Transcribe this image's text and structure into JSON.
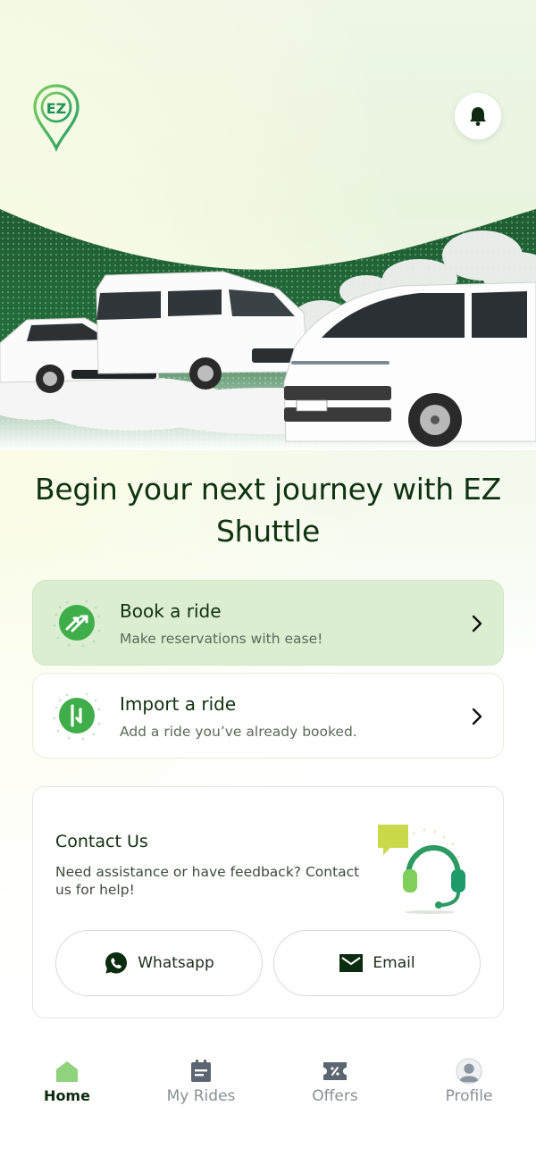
{
  "brand": {
    "logo_text": "EZ",
    "accent": "#3fae4a",
    "dark": "#0f3311"
  },
  "header": {
    "notification_icon": "bell-icon"
  },
  "hero": {
    "headline": "Begin your next journey with EZ Shuttle"
  },
  "actions": [
    {
      "title": "Book a ride",
      "subtitle": "Make reservations with ease!",
      "icon": "swap-arrows-icon"
    },
    {
      "title": "Import a ride",
      "subtitle": "Add a ride you’ve already booked.",
      "icon": "import-icon"
    }
  ],
  "contact": {
    "title": "Contact Us",
    "description": "Need assistance or have feedback? Contact us for help!",
    "whatsapp_label": "Whatsapp",
    "email_label": "Email"
  },
  "nav": [
    {
      "label": "Home",
      "icon": "home-icon",
      "active": true
    },
    {
      "label": "My Rides",
      "icon": "rides-icon",
      "active": false
    },
    {
      "label": "Offers",
      "icon": "offers-icon",
      "active": false
    },
    {
      "label": "Profile",
      "icon": "profile-icon",
      "active": false
    }
  ]
}
